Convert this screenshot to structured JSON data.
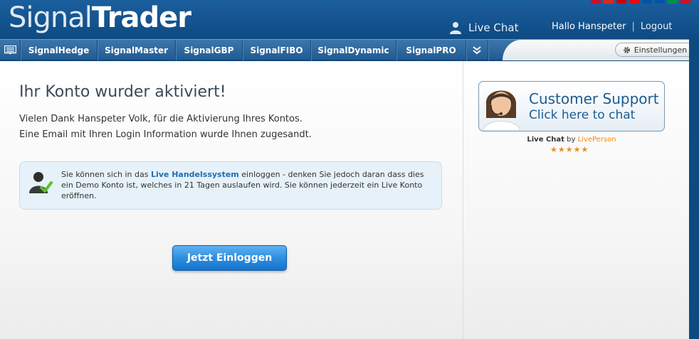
{
  "brand": {
    "part1": "Signal",
    "part2": "Trader"
  },
  "header": {
    "live_chat": "Live Chat",
    "greeting": "Hallo Hanspeter",
    "separator": "|",
    "logout": "Logout",
    "flag_colors": [
      "#c8102e",
      "#d52b1e",
      "#cc0000",
      "#e30a17",
      "#0055a4",
      "#0055a4",
      "#009246",
      "#ce1126"
    ]
  },
  "nav": {
    "menu_icon": "menu-icon",
    "items": [
      "SignalHedge",
      "SignalMaster",
      "SignalGBP",
      "SignalFIBO",
      "SignalDynamic",
      "SignalPRO"
    ],
    "more_icon": "double-chevron-down-icon",
    "settings": "Einstellungen"
  },
  "main": {
    "title": "Ihr Konto wurder aktiviert!",
    "intro_1": "Vielen Dank Hanspeter Volk, für die Aktivierung Ihres Kontos.",
    "intro_2": "Eine Email mit Ihren Login Information wurde Ihnen zugesandt.",
    "notice": {
      "icon": "user-check-icon",
      "before": "Sie können sich in das ",
      "highlight": "Live Handelssystem",
      "after": " einloggen - denken Sie jedoch daran dass dies ein Demo Konto ist, welches in 21 Tagen auslaufen wird. Sie können jederzeit ein Live Konto eröffnen."
    },
    "login_button": "Jetzt Einloggen"
  },
  "sidebar": {
    "support_title": "Customer Support",
    "support_sub": "Click here to chat",
    "credit_live": "Live Chat",
    "credit_by": " by ",
    "credit_provider": "LivePerson",
    "stars": 5,
    "accent": "#f08a1c"
  }
}
